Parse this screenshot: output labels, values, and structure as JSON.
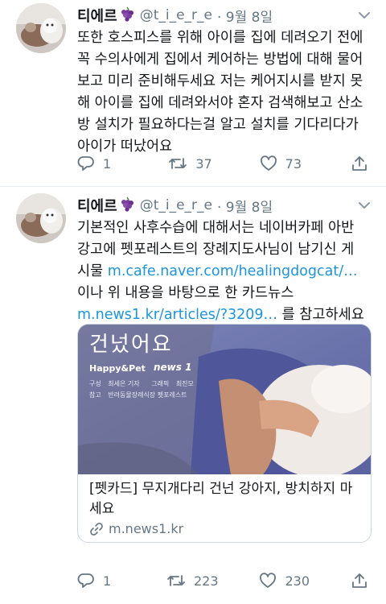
{
  "tweets": [
    {
      "author_name": "티에르",
      "handle": "@t_i_e_r_e",
      "date": "· 9월 8일",
      "text_lines": [
        "또한 호스피스를 위해 아이를 집에 데려오기 전에",
        "꼭 수의사에게 집에서 케어하는 방법에 대해 물어",
        "보고 미리 준비해두세요 저는 케어지시를 받지 못",
        "해 아이를 집에 데려와서야 혼자 검색해보고 산소",
        "방 설치가 필요하다는걸 알고 설치를 기다리다가",
        "아이가 떠났어요"
      ],
      "replies": "1",
      "retweets": "37",
      "likes": "73"
    },
    {
      "author_name": "티에르",
      "handle": "@t_i_e_r_e",
      "date": "· 9월 8일",
      "text_lines": [
        "기본적인 사후수습에 대해서는 네이버카페 아반",
        "강고에 펫포레스트의 장례지도사님이 남기신 게"
      ],
      "line3_prefix": "시물 ",
      "line3_link": "m.cafe.naver.com/healingdogcat/…",
      "line4": "이나 위 내용을 바탕으로 한 카드뉴스",
      "line5_link": "m.news1.kr/articles/?3209…",
      "line5_suffix": " 를 참고하세요",
      "card": {
        "image_heading": "건넜어요",
        "image_logo1": "Happy&Pet",
        "image_logo2": "news 1",
        "credit_label1": "구성",
        "credit_value1": "최세은 기자",
        "credit_label2": "그래픽",
        "credit_value2": "최진모",
        "credit_label3": "참고",
        "credit_value3": "반려동물장례식장 펫포레스트",
        "title": "[펫카드] 무지개다리 건넌 강아지, 방치하지 마세요",
        "domain": "m.news1.kr"
      },
      "replies": "1",
      "retweets": "223",
      "likes": "230"
    }
  ],
  "colors": {
    "text": "#14171a",
    "secondary": "#657786",
    "link": "#1b95e0",
    "divider": "#e6ecf0"
  },
  "icons": [
    "avatar",
    "grape-emoji",
    "chevron-down-icon",
    "reply-icon",
    "retweet-icon",
    "like-icon",
    "share-icon",
    "link-icon"
  ]
}
